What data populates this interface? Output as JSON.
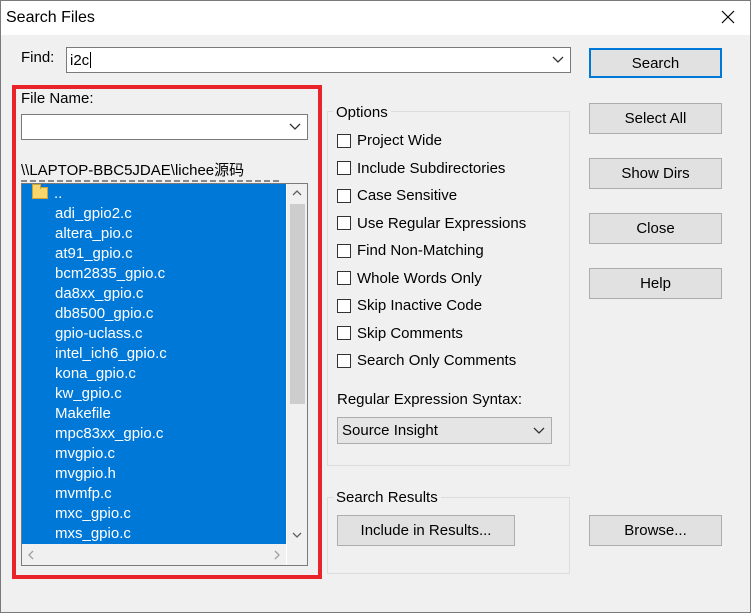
{
  "window": {
    "title": "Search Files"
  },
  "find": {
    "label": "Find:",
    "value": "i2c"
  },
  "file_name": {
    "label": "File Name:",
    "value": ""
  },
  "path": "\\\\LAPTOP-BBC5JDAE\\lichee源码",
  "files": [
    "adi_gpio2.c",
    "altera_pio.c",
    "at91_gpio.c",
    "bcm2835_gpio.c",
    "da8xx_gpio.c",
    "db8500_gpio.c",
    "gpio-uclass.c",
    "intel_ich6_gpio.c",
    "kona_gpio.c",
    "kw_gpio.c",
    "Makefile",
    "mpc83xx_gpio.c",
    "mvgpio.c",
    "mvgpio.h",
    "mvmfp.c",
    "mxc_gpio.c",
    "mxs_gpio.c"
  ],
  "parent_dir": "..",
  "options": {
    "title": "Options",
    "items": [
      "Project Wide",
      "Include Subdirectories",
      "Case Sensitive",
      "Use Regular Expressions",
      "Find Non-Matching",
      "Whole Words Only",
      "Skip Inactive Code",
      "Skip Comments",
      "Search Only Comments"
    ]
  },
  "regex_syntax": {
    "label": "Regular Expression Syntax:",
    "value": "Source Insight"
  },
  "results": {
    "title": "Search Results",
    "button": "Include in Results..."
  },
  "buttons": {
    "search": "Search",
    "select_all": "Select All",
    "show_dirs": "Show Dirs",
    "close": "Close",
    "help": "Help",
    "browse": "Browse..."
  },
  "colors": {
    "selection": "#0078d7",
    "highlight_border": "#e8232a",
    "default_button_border": "#0078d7"
  }
}
